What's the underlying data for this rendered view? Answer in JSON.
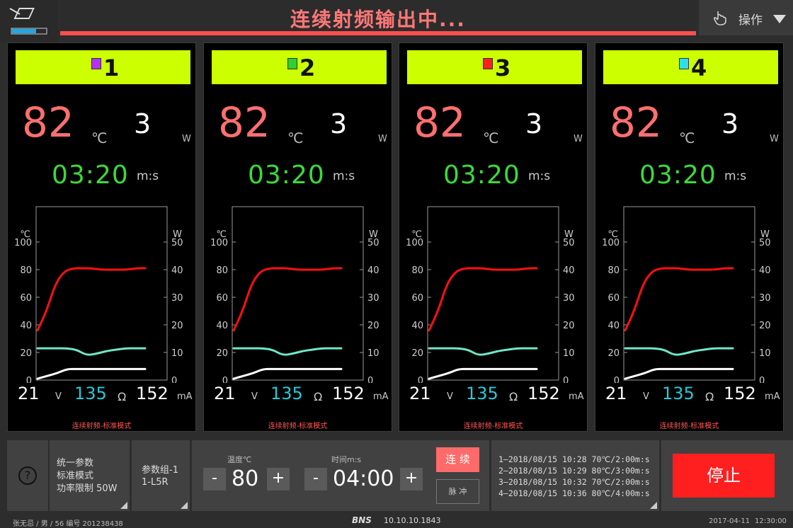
{
  "status": {
    "text": "连续射频输出中..."
  },
  "operation": {
    "label": "操作"
  },
  "channels": [
    {
      "id": "1",
      "color": "#b333f0",
      "temp": "82",
      "temp_unit": "℃",
      "power": "3",
      "power_unit": "W",
      "time": "03:20",
      "time_unit": "m:s",
      "voltage": "21",
      "voltage_unit": "V",
      "impedance": "135",
      "impedance_unit": "Ω",
      "current": "152",
      "current_unit": "mA",
      "mode": "连续射频-标准模式"
    },
    {
      "id": "2",
      "color": "#2ed12e",
      "temp": "82",
      "temp_unit": "℃",
      "power": "3",
      "power_unit": "W",
      "time": "03:20",
      "time_unit": "m:s",
      "voltage": "21",
      "voltage_unit": "V",
      "impedance": "135",
      "impedance_unit": "Ω",
      "current": "152",
      "current_unit": "mA",
      "mode": "连续射频-标准模式"
    },
    {
      "id": "3",
      "color": "#ff1f1f",
      "temp": "82",
      "temp_unit": "℃",
      "power": "3",
      "power_unit": "W",
      "time": "03:20",
      "time_unit": "m:s",
      "voltage": "21",
      "voltage_unit": "V",
      "impedance": "135",
      "impedance_unit": "Ω",
      "current": "152",
      "current_unit": "mA",
      "mode": "连续射频-标准模式"
    },
    {
      "id": "4",
      "color": "#2de0f0",
      "temp": "82",
      "temp_unit": "℃",
      "power": "3",
      "power_unit": "W",
      "time": "03:20",
      "time_unit": "m:s",
      "voltage": "21",
      "voltage_unit": "V",
      "impedance": "135",
      "impedance_unit": "Ω",
      "current": "152",
      "current_unit": "mA",
      "mode": "连续射频-标准模式"
    }
  ],
  "chart_data": {
    "type": "line",
    "left_axis": {
      "ticks": [
        "100",
        "80",
        "60",
        "40",
        "20",
        "0"
      ],
      "unit": "℃",
      "range": [
        0,
        100
      ]
    },
    "right_axis": {
      "ticks": [
        "50",
        "40",
        "30",
        "20",
        "10",
        "0"
      ],
      "unit": "W",
      "range": [
        0,
        50
      ]
    },
    "series": [
      {
        "color": "#ff1010",
        "axis": "left",
        "values": [
          36,
          50,
          70,
          79,
          81,
          81,
          81,
          80,
          80,
          80,
          80,
          81,
          81
        ]
      },
      {
        "color": "#6fe8c9",
        "axis": "left",
        "values": [
          23,
          23,
          23,
          23,
          22,
          18,
          19,
          21,
          22,
          23,
          23,
          23
        ]
      },
      {
        "color": "#ffffff",
        "axis": "left",
        "values": [
          1,
          3,
          5,
          8,
          8,
          8,
          8,
          8,
          8,
          8,
          8,
          8
        ]
      }
    ]
  },
  "bottom": {
    "params": {
      "line1": "统一参数",
      "line2": "标准模式",
      "line3": "功率限制 50W"
    },
    "group": {
      "line1": "参数组-1",
      "line2": "1-L5R"
    },
    "temperature": {
      "label": "温度℃",
      "value": "80",
      "minus": "-",
      "plus": "+"
    },
    "time": {
      "label": "时间m:s",
      "value": "04:00",
      "minus": "-",
      "plus": "+"
    },
    "mode_continuous": "连 续",
    "mode_pulse": "脉 冲",
    "history": [
      "1–2018/08/15 10:28  70℃/2:00m:s",
      "2–2018/08/15 10:29  80℃/3:00m:s",
      "3–2018/08/15 10:32  70℃/2:00m:s",
      "4–2018/08/15 10:36  80℃/4:00m:s"
    ],
    "stop": "停止",
    "help": "?"
  },
  "footer": {
    "patient": "张无忌 / 男 / 56   编号 201238438",
    "brand": "BNS",
    "ip": "10.10.10.1843",
    "date": "2017-04-11",
    "time": "12:30:00"
  }
}
